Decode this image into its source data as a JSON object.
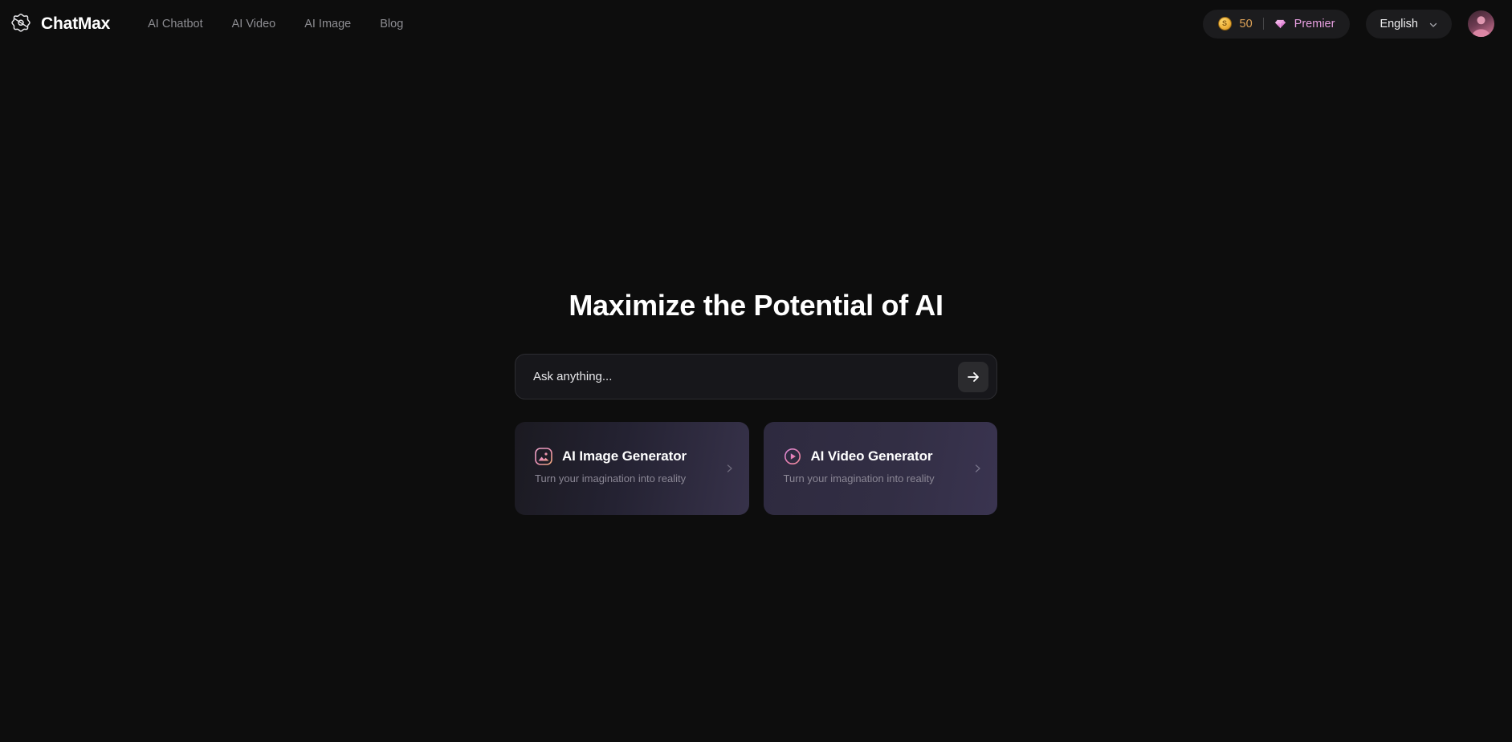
{
  "header": {
    "logo_icon": "gear-atom-icon",
    "brand_name": "ChatMax",
    "nav": [
      {
        "label": "AI Chatbot"
      },
      {
        "label": "AI Video"
      },
      {
        "label": "AI Image"
      },
      {
        "label": "Blog"
      }
    ],
    "status": {
      "coin_icon": "coin-icon",
      "coin_glyph": "S",
      "credits": "50",
      "gem_icon": "diamond-icon",
      "plan": "Premier",
      "credits_color": "#e0a458",
      "plan_color": "#e79fe0"
    },
    "language": {
      "selected": "English",
      "chevron_icon": "chevron-down-icon"
    },
    "avatar": {
      "icon": "user-avatar"
    }
  },
  "main": {
    "title": "Maximize the Potential of AI",
    "ask": {
      "value": "",
      "placeholder": "Ask anything...",
      "send_icon": "arrow-right-icon"
    },
    "cards": [
      {
        "icon": "image-icon",
        "title": "AI Image Generator",
        "subtitle": "Turn your imagination into reality",
        "chevron_icon": "chevron-right-icon"
      },
      {
        "icon": "play-circle-icon",
        "title": "AI Video Generator",
        "subtitle": "Turn your imagination into reality",
        "chevron_icon": "chevron-right-icon"
      }
    ]
  },
  "theme": {
    "background": "#0d0d0d",
    "accent_pink": "#e79fe0",
    "accent_gold": "#e0a458"
  }
}
